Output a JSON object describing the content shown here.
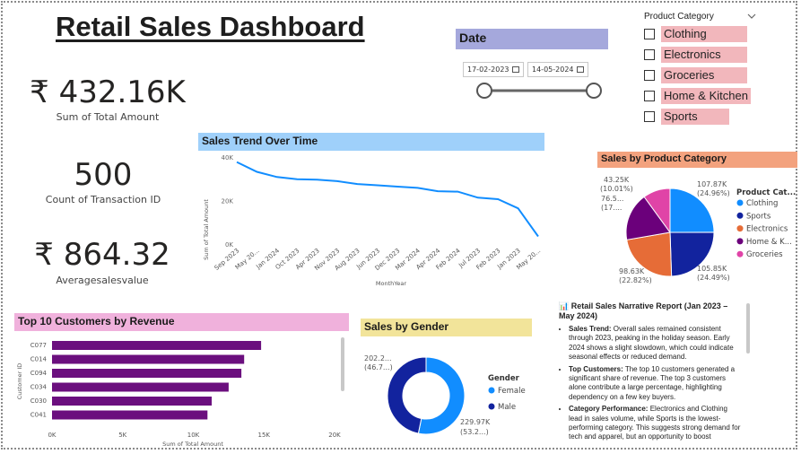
{
  "title": "Retail Sales Dashboard",
  "kpis": {
    "total_amount": {
      "value": "₹ 432.16K",
      "label": "Sum of Total Amount"
    },
    "transactions": {
      "value": "500",
      "label": "Count of Transaction ID"
    },
    "avg_sales": {
      "value": "₹ 864.32",
      "label": "Averagesalesvalue"
    }
  },
  "date_slicer": {
    "header": "Date",
    "start": "17-02-2023",
    "end": "14-05-2024",
    "range": [
      0,
      1
    ]
  },
  "category_slicer": {
    "header": "Product Category",
    "items": [
      "Clothing",
      "Electronics",
      "Groceries",
      "Home & Kitchen",
      "Sports"
    ]
  },
  "colors": {
    "blue": "#118dff",
    "navy": "#12239e",
    "orange": "#e66c37",
    "purple": "#6b007b",
    "pink": "#e044a7",
    "bar": "#6b0f7e"
  },
  "trend": {
    "header": "Sales Trend Over Time",
    "ylabel": "Sum of Total Amount",
    "xlabel": "MonthYear",
    "yticks": [
      "40K",
      "20K",
      "0K"
    ],
    "xlabels": [
      "Sep 2023",
      "May 20...",
      "Jan 2024",
      "Oct 2023",
      "Apr 2023",
      "Nov 2023",
      "Aug 2023",
      "Jun 2023",
      "Dec 2023",
      "Mar 2024",
      "Apr 2024",
      "Feb 2024",
      "Jul 2023",
      "Feb 2023",
      "Jan 2023",
      "May 20..."
    ],
    "chart_data": {
      "type": "line",
      "x": [
        "Sep 2023",
        "May 20...",
        "Jan 2024",
        "Oct 2023",
        "Apr 2023",
        "Nov 2023",
        "Aug 2023",
        "Jun 2023",
        "Dec 2023",
        "Mar 2024",
        "Apr 2024",
        "Feb 2024",
        "Jul 2023",
        "Feb 2023",
        "Jan 2023",
        "May 20..."
      ],
      "values": [
        37700,
        33200,
        30800,
        29800,
        29600,
        28900,
        27600,
        27000,
        26400,
        25800,
        24300,
        24100,
        21300,
        20600,
        16400,
        3500
      ],
      "ylim": [
        0,
        40000
      ]
    }
  },
  "category_chart": {
    "header": "Sales by Product Category",
    "legend_title": "Product Cat...",
    "legend": [
      "Clothing",
      "Sports",
      "Electronics",
      "Home & K...",
      "Groceries"
    ],
    "labels": {
      "clothing": [
        "107.87K",
        "(24.96%)"
      ],
      "sports": [
        "105.85K",
        "(24.49%)"
      ],
      "electronics": [
        "98.63K",
        "(22.82%)"
      ],
      "home": [
        "76.5...",
        "(17...."
      ],
      "groceries": [
        "43.25K",
        "(10.01%)"
      ]
    },
    "chart_data": {
      "type": "pie",
      "categories": [
        "Clothing",
        "Sports",
        "Electronics",
        "Home & Kitchen",
        "Groceries"
      ],
      "values": [
        107.87,
        105.85,
        98.63,
        76.5,
        43.25
      ],
      "unit": "K"
    }
  },
  "customers": {
    "header": "Top 10 Customers by Revenue",
    "ylabel": "Customer ID",
    "xlabel": "Sum of Total Amount",
    "xticks": [
      "0K",
      "5K",
      "10K",
      "15K",
      "20K"
    ],
    "chart_data": {
      "type": "bar",
      "categories": [
        "C077",
        "C014",
        "C094",
        "C034",
        "C030",
        "C041"
      ],
      "values": [
        14800,
        13600,
        13400,
        12500,
        11300,
        11000
      ],
      "xlim": [
        0,
        20000
      ]
    }
  },
  "gender": {
    "header": "Sales by Gender",
    "legend_title": "Gender",
    "legend": [
      "Female",
      "Male"
    ],
    "labels": {
      "male": [
        "202.2...",
        "(46.7...)"
      ],
      "female": [
        "229.97K",
        "(53.2...)"
      ]
    },
    "chart_data": {
      "type": "pie",
      "categories": [
        "Female",
        "Male"
      ],
      "values": [
        229.97,
        202.2
      ],
      "unit": "K"
    }
  },
  "narrative": {
    "title": "📊 Retail Sales Narrative Report (Jan 2023 – May 2024)",
    "points": [
      {
        "label": "Sales Trend:",
        "text": " Overall sales remained consistent through 2023, peaking in the holiday season. Early 2024 shows a slight slowdown, which could indicate seasonal effects or reduced demand."
      },
      {
        "label": "Top Customers:",
        "text": " The top 10 customers generated a significant share of revenue. The top 3 customers alone contribute a large percentage, highlighting dependency on a few key buyers."
      },
      {
        "label": "Category Performance:",
        "text": " Electronics and Clothing lead in sales volume, while Sports is the lowest-performing category. This suggests strong demand for tech and apparel, but an opportunity to boost"
      }
    ]
  }
}
